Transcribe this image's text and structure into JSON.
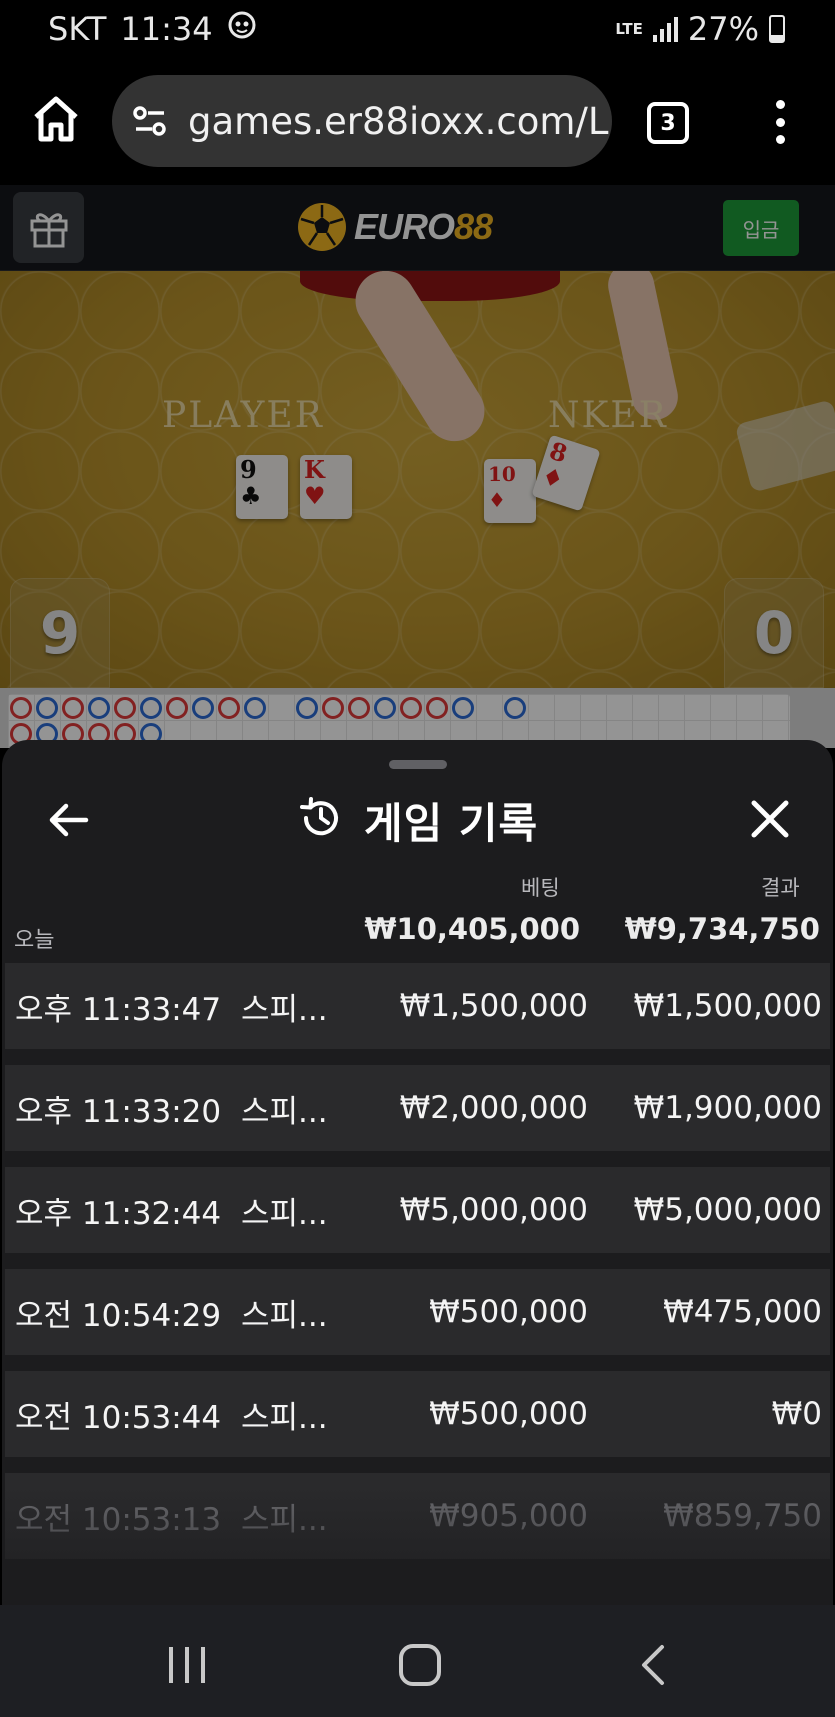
{
  "status_bar": {
    "carrier": "SKT",
    "time": "11:34",
    "network": "LTE",
    "battery": "27%"
  },
  "browser": {
    "url": "games.er88ioxx.com/L",
    "tab_count": "3"
  },
  "site": {
    "logo_part1": "EURO",
    "logo_part2": "88",
    "deposit_label": "입금"
  },
  "game": {
    "player_label": "PLAYER",
    "banker_label": "NKER",
    "player_score": "9",
    "banker_score": "0",
    "player_cards": [
      {
        "rank": "9",
        "suit": "♣"
      },
      {
        "rank": "K",
        "suit": "♥"
      }
    ],
    "banker_cards": [
      {
        "rank": "10",
        "suit": "♦"
      },
      {
        "rank": "8",
        "suit": "♦"
      }
    ]
  },
  "history_sheet": {
    "title": "게임 기록",
    "col_bet": "베팅",
    "col_result": "결과",
    "today_label": "오늘",
    "today_bet_total": "₩10,405,000",
    "today_result_total": "₩9,734,750",
    "rows": [
      {
        "time": "오후 11:33:47",
        "game": "스피...",
        "bet": "₩1,500,000",
        "result": "₩1,500,000"
      },
      {
        "time": "오후 11:33:20",
        "game": "스피...",
        "bet": "₩2,000,000",
        "result": "₩1,900,000"
      },
      {
        "time": "오후 11:32:44",
        "game": "스피...",
        "bet": "₩5,000,000",
        "result": "₩5,000,000"
      },
      {
        "time": "오전 10:54:29",
        "game": "스피...",
        "bet": "₩500,000",
        "result": "₩475,000"
      },
      {
        "time": "오전 10:53:44",
        "game": "스피...",
        "bet": "₩500,000",
        "result": "₩0"
      },
      {
        "time": "오전 10:53:13",
        "game": "스피...",
        "bet": "₩905,000",
        "result": "₩859,750"
      }
    ]
  },
  "colors": {
    "deposit_green": "#1e9c3a",
    "logo_gold": "#f2b624",
    "sheet_bg": "#1c1c1e",
    "row_bg": "#2a2a2c",
    "table_felt": "#b8922c"
  },
  "icons": [
    "home-icon",
    "tune-icon",
    "tabs-icon",
    "more-icon",
    "gift-icon",
    "back-arrow-icon",
    "history-icon",
    "close-icon",
    "recents-icon",
    "home-nav-icon",
    "back-nav-icon"
  ]
}
